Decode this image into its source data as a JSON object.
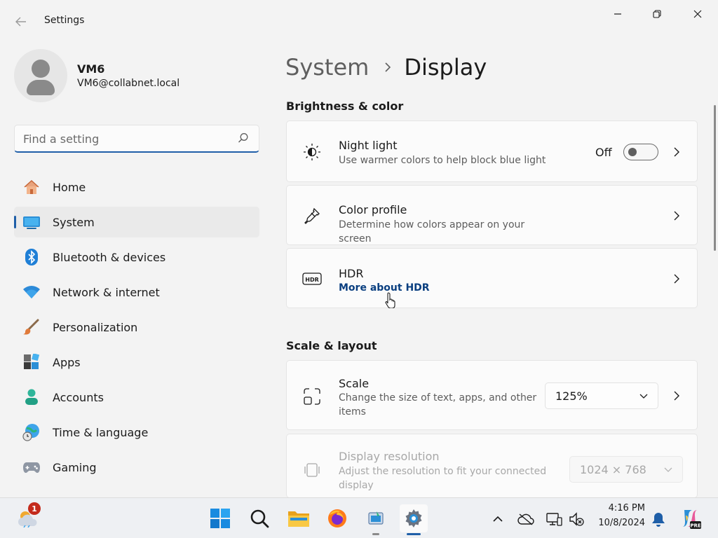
{
  "window": {
    "title": "Settings"
  },
  "profile": {
    "name": "VM6",
    "email": "VM6@collabnet.local"
  },
  "search": {
    "placeholder": "Find a setting"
  },
  "sidebar": {
    "items": [
      {
        "label": "Home",
        "icon": "home-icon",
        "active": false
      },
      {
        "label": "System",
        "icon": "system-icon",
        "active": true
      },
      {
        "label": "Bluetooth & devices",
        "icon": "bluetooth-icon",
        "active": false
      },
      {
        "label": "Network & internet",
        "icon": "wifi-icon",
        "active": false
      },
      {
        "label": "Personalization",
        "icon": "paintbrush-icon",
        "active": false
      },
      {
        "label": "Apps",
        "icon": "apps-icon",
        "active": false
      },
      {
        "label": "Accounts",
        "icon": "accounts-icon",
        "active": false
      },
      {
        "label": "Time & language",
        "icon": "globe-clock-icon",
        "active": false
      },
      {
        "label": "Gaming",
        "icon": "gamepad-icon",
        "active": false
      }
    ]
  },
  "breadcrumb": {
    "parent": "System",
    "current": "Display"
  },
  "sections": {
    "brightness": {
      "header": "Brightness & color",
      "night_light": {
        "title": "Night light",
        "subtitle": "Use warmer colors to help block blue light",
        "toggle_label": "Off",
        "toggle_on": false
      },
      "color_profile": {
        "title": "Color profile",
        "subtitle": "Determine how colors appear on your screen"
      },
      "hdr": {
        "title": "HDR",
        "link": "More about HDR"
      }
    },
    "scale_layout": {
      "header": "Scale & layout",
      "scale": {
        "title": "Scale",
        "subtitle": "Change the size of text, apps, and other items",
        "value": "125%"
      },
      "resolution": {
        "title": "Display resolution",
        "subtitle": "Adjust the resolution to fit your connected display",
        "value": "1024 × 768",
        "enabled": false
      }
    }
  },
  "taskbar": {
    "weather_badge": "1",
    "clock_time": "4:16 PM",
    "clock_date": "10/8/2024",
    "accent": "#1f5fa8"
  }
}
